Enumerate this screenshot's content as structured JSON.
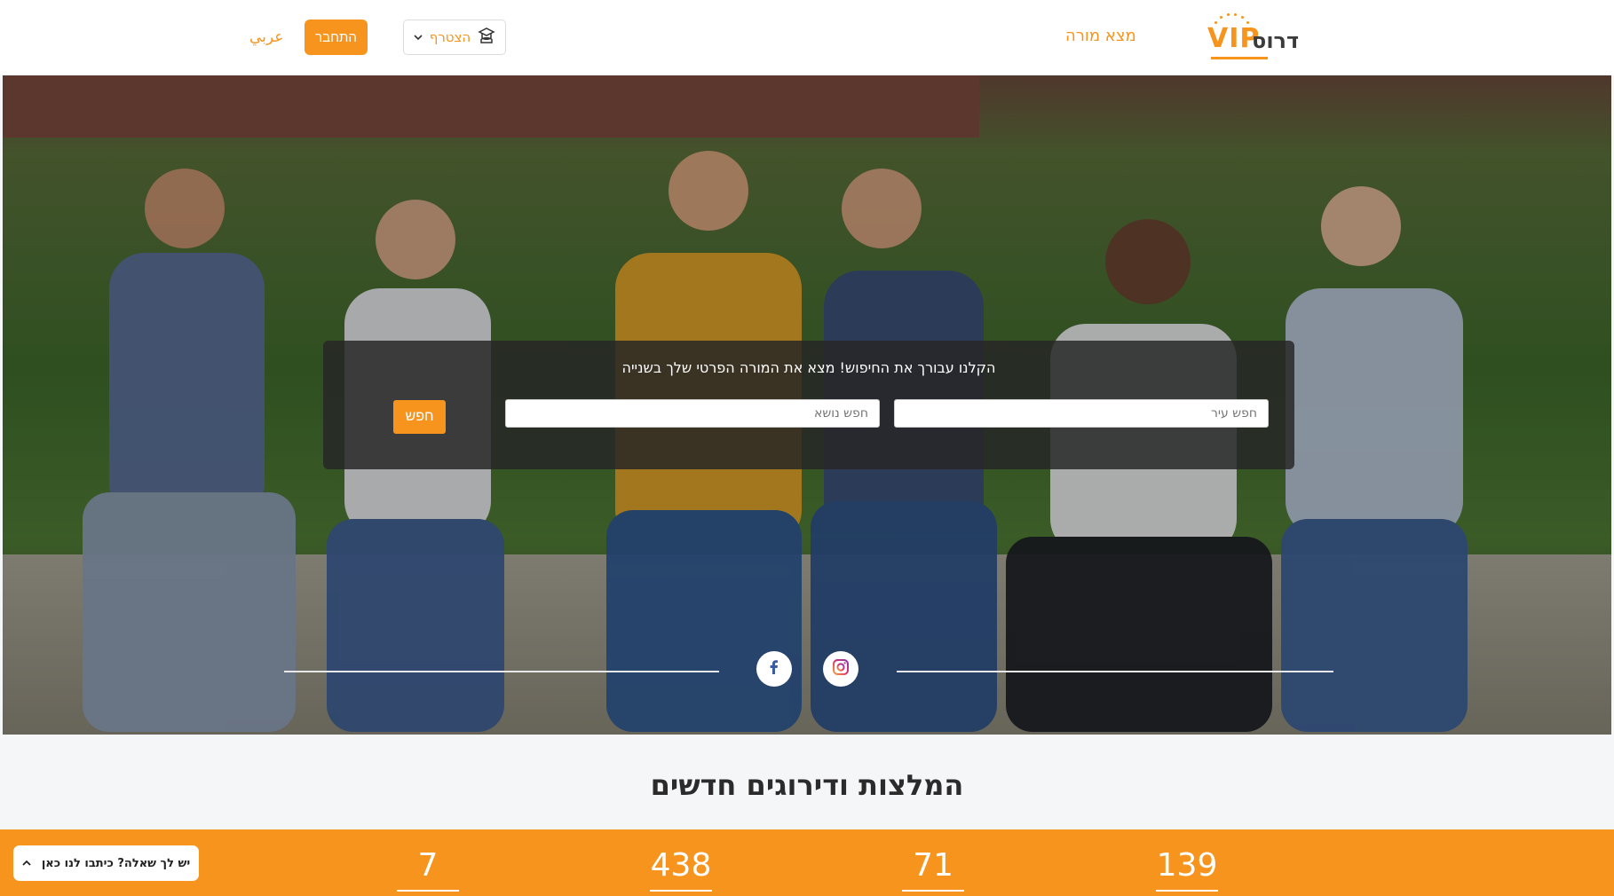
{
  "header": {
    "logo_vip": "VIP",
    "logo_text": "דרוס",
    "find_teacher": "מצא מורה",
    "join_label": "הצטרף",
    "login_label": "התחבר",
    "language_link": "عربي"
  },
  "hero": {
    "search_title": "הקלנו עבורך את החיפוש! מצא את המורה הפרטי שלך בשנייה",
    "city_placeholder": "חפש עיר",
    "subject_placeholder": "חפש נושא",
    "search_button": "חפש"
  },
  "icons": {
    "join": "graduate-icon",
    "chevron": "chevron-down-icon",
    "facebook": "facebook-icon",
    "instagram": "instagram-icon",
    "chat_caret": "chevron-up-icon"
  },
  "section": {
    "heading": "המלצות ודירוגים חדשים"
  },
  "stats": [
    "139",
    "71",
    "438",
    "7"
  ],
  "chat": {
    "label": "יש לך שאלה? כיתבו לנו כאן"
  },
  "colors": {
    "accent": "#f7941d",
    "panel": "#262626"
  }
}
